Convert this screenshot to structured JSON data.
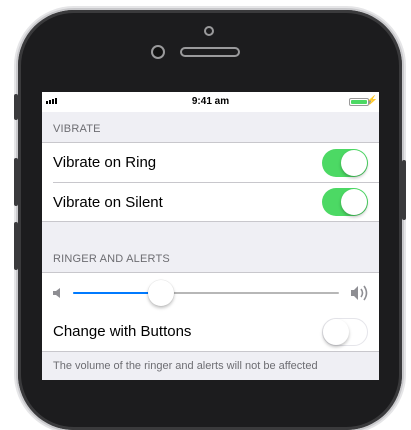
{
  "status_bar": {
    "time": "9:41 am"
  },
  "vibrate": {
    "header": "VIBRATE",
    "rows": [
      {
        "label": "Vibrate on Ring",
        "on": true
      },
      {
        "label": "Vibrate on Silent",
        "on": true
      }
    ]
  },
  "ringer": {
    "header": "RINGER AND ALERTS",
    "volume_fraction": 0.33,
    "change_with_buttons": {
      "label": "Change with Buttons",
      "on": false
    },
    "footer": "The volume of the ringer and alerts will not be affected"
  },
  "colors": {
    "accent": "#007aff",
    "toggle_on": "#4cd964"
  }
}
